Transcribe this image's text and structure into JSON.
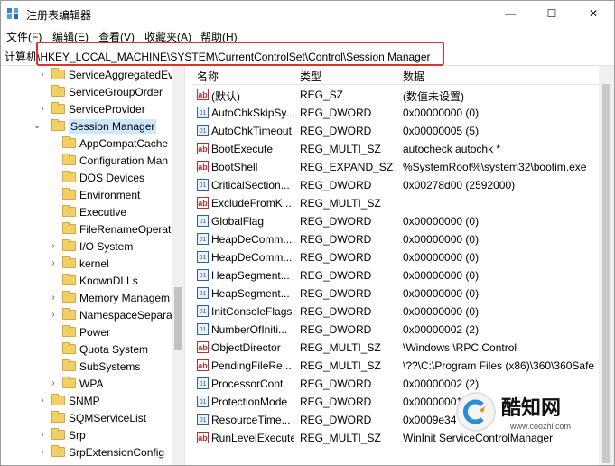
{
  "window": {
    "title": "注册表编辑器",
    "controls": {
      "minimize": "—",
      "maximize": "☐",
      "close": "✕"
    }
  },
  "menu": [
    "文件(F)",
    "编辑(E)",
    "查看(V)",
    "收藏夹(A)",
    "帮助(H)"
  ],
  "address": {
    "path": "计算机\\HKEY_LOCAL_MACHINE\\SYSTEM\\CurrentControlSet\\Control\\Session Manager"
  },
  "tree": {
    "items": [
      {
        "label": "ServiceAggregatedEv",
        "expandable": true
      },
      {
        "label": "ServiceGroupOrder",
        "expandable": false
      },
      {
        "label": "ServiceProvider",
        "expandable": true
      },
      {
        "label": "Session Manager",
        "expandable": true,
        "expanded": true,
        "selected": true
      },
      {
        "label": "AppCompatCache",
        "expandable": false
      },
      {
        "label": "Configuration Man",
        "expandable": false
      },
      {
        "label": "DOS Devices",
        "expandable": false
      },
      {
        "label": "Environment",
        "expandable": false
      },
      {
        "label": "Executive",
        "expandable": false
      },
      {
        "label": "FileRenameOperati",
        "expandable": false
      },
      {
        "label": "I/O System",
        "expandable": true
      },
      {
        "label": "kernel",
        "expandable": true
      },
      {
        "label": "KnownDLLs",
        "expandable": false
      },
      {
        "label": "Memory Managem",
        "expandable": true
      },
      {
        "label": "NamespaceSepara",
        "expandable": true
      },
      {
        "label": "Power",
        "expandable": false
      },
      {
        "label": "Quota System",
        "expandable": false
      },
      {
        "label": "SubSystems",
        "expandable": false
      },
      {
        "label": "WPA",
        "expandable": true
      },
      {
        "label": "SNMP",
        "expandable": true
      },
      {
        "label": "SQMServiceList",
        "expandable": false
      },
      {
        "label": "Srp",
        "expandable": true
      },
      {
        "label": "SrpExtensionConfig",
        "expandable": true
      }
    ]
  },
  "list": {
    "columns": [
      "名称",
      "类型",
      "数据"
    ],
    "rows": [
      {
        "icon": "string-value-icon",
        "name": "(默认)",
        "type": "REG_SZ",
        "data": "(数值未设置)"
      },
      {
        "icon": "binary-value-icon",
        "name": "AutoChkSkipSy...",
        "type": "REG_DWORD",
        "data": "0x00000000 (0)"
      },
      {
        "icon": "binary-value-icon",
        "name": "AutoChkTimeout",
        "type": "REG_DWORD",
        "data": "0x00000005 (5)"
      },
      {
        "icon": "string-value-icon",
        "name": "BootExecute",
        "type": "REG_MULTI_SZ",
        "data": "autocheck autochk *"
      },
      {
        "icon": "string-value-icon",
        "name": "BootShell",
        "type": "REG_EXPAND_SZ",
        "data": "%SystemRoot%\\system32\\bootim.exe"
      },
      {
        "icon": "binary-value-icon",
        "name": "CriticalSection...",
        "type": "REG_DWORD",
        "data": "0x00278d00 (2592000)"
      },
      {
        "icon": "string-value-icon",
        "name": "ExcludeFromK...",
        "type": "REG_MULTI_SZ",
        "data": ""
      },
      {
        "icon": "binary-value-icon",
        "name": "GlobalFlag",
        "type": "REG_DWORD",
        "data": "0x00000000 (0)"
      },
      {
        "icon": "binary-value-icon",
        "name": "HeapDeComm...",
        "type": "REG_DWORD",
        "data": "0x00000000 (0)"
      },
      {
        "icon": "binary-value-icon",
        "name": "HeapDeComm...",
        "type": "REG_DWORD",
        "data": "0x00000000 (0)"
      },
      {
        "icon": "binary-value-icon",
        "name": "HeapSegment...",
        "type": "REG_DWORD",
        "data": "0x00000000 (0)"
      },
      {
        "icon": "binary-value-icon",
        "name": "HeapSegment...",
        "type": "REG_DWORD",
        "data": "0x00000000 (0)"
      },
      {
        "icon": "binary-value-icon",
        "name": "InitConsoleFlags",
        "type": "REG_DWORD",
        "data": "0x00000000 (0)"
      },
      {
        "icon": "binary-value-icon",
        "name": "NumberOfIniti...",
        "type": "REG_DWORD",
        "data": "0x00000002 (2)"
      },
      {
        "icon": "string-value-icon",
        "name": "ObjectDirector",
        "type": "REG_MULTI_SZ",
        "data": "\\Windows \\RPC Control"
      },
      {
        "icon": "string-value-icon",
        "name": "PendingFileRe...",
        "type": "REG_MULTI_SZ",
        "data": "\\??\\C:\\Program Files (x86)\\360\\360Safe"
      },
      {
        "icon": "binary-value-icon",
        "name": "ProcessorCont",
        "type": "REG_DWORD",
        "data": "0x00000002 (2)"
      },
      {
        "icon": "binary-value-icon",
        "name": "ProtectionMode",
        "type": "REG_DWORD",
        "data": "0x00000001"
      },
      {
        "icon": "binary-value-icon",
        "name": "ResourceTime...",
        "type": "REG_DWORD",
        "data": "0x0009e34"
      },
      {
        "icon": "string-value-icon",
        "name": "RunLevelExecute",
        "type": "REG_MULTI_SZ",
        "data": "WinInit ServiceControlManager"
      }
    ]
  },
  "watermark": {
    "name": "酷知网",
    "url": "www.coozhi.com"
  },
  "colors": {
    "highlight_box": "#e03030",
    "selection": "#cce8ff",
    "folder": "#f3cf6a"
  }
}
